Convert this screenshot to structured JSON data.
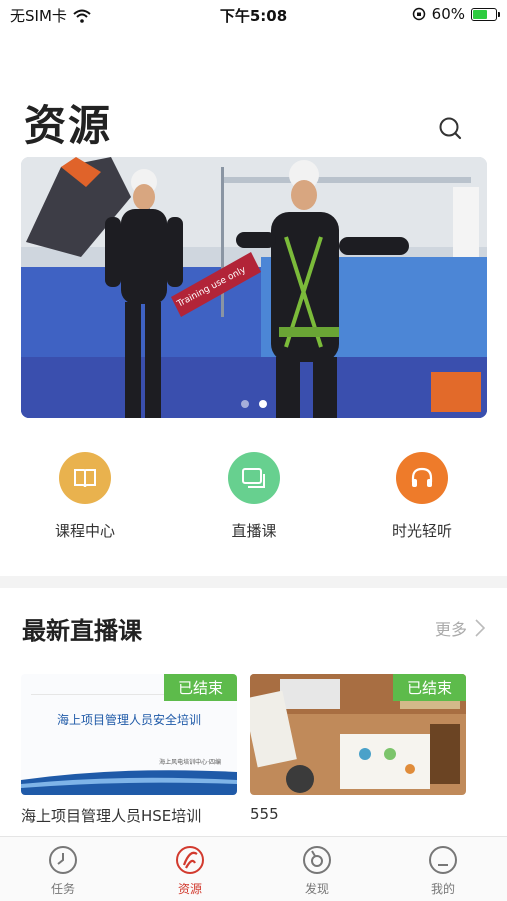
{
  "status": {
    "carrier": "无SIM卡",
    "time": "下午5:08",
    "battery": "60%"
  },
  "page_title": "资源",
  "banner": {
    "overlay_text": "Training use only",
    "slide_count": 2,
    "active_slide": 2
  },
  "quick": [
    {
      "label": "课程中心",
      "icon": "book-icon",
      "color": "#e9b24e"
    },
    {
      "label": "直播课",
      "icon": "live-screen-icon",
      "color": "#67d08f"
    },
    {
      "label": "时光轻听",
      "icon": "headphones-icon",
      "color": "#ee7b2a"
    }
  ],
  "section": {
    "title": "最新直播课",
    "more": "更多"
  },
  "cards": [
    {
      "badge": "已结束",
      "thumb_title": "海上项目管理人员安全培训",
      "thumb_sub": "海上风电培训中心·四编",
      "title": "海上项目管理人员HSE培训"
    },
    {
      "badge": "已结束",
      "title": "555"
    }
  ],
  "tabs": [
    {
      "label": "任务",
      "icon": "clock-icon"
    },
    {
      "label": "资源",
      "icon": "resource-icon"
    },
    {
      "label": "发现",
      "icon": "compass-icon"
    },
    {
      "label": "我的",
      "icon": "profile-icon"
    }
  ],
  "colors": {
    "accent": "#d23a2e",
    "badge": "#5dbb4b"
  }
}
